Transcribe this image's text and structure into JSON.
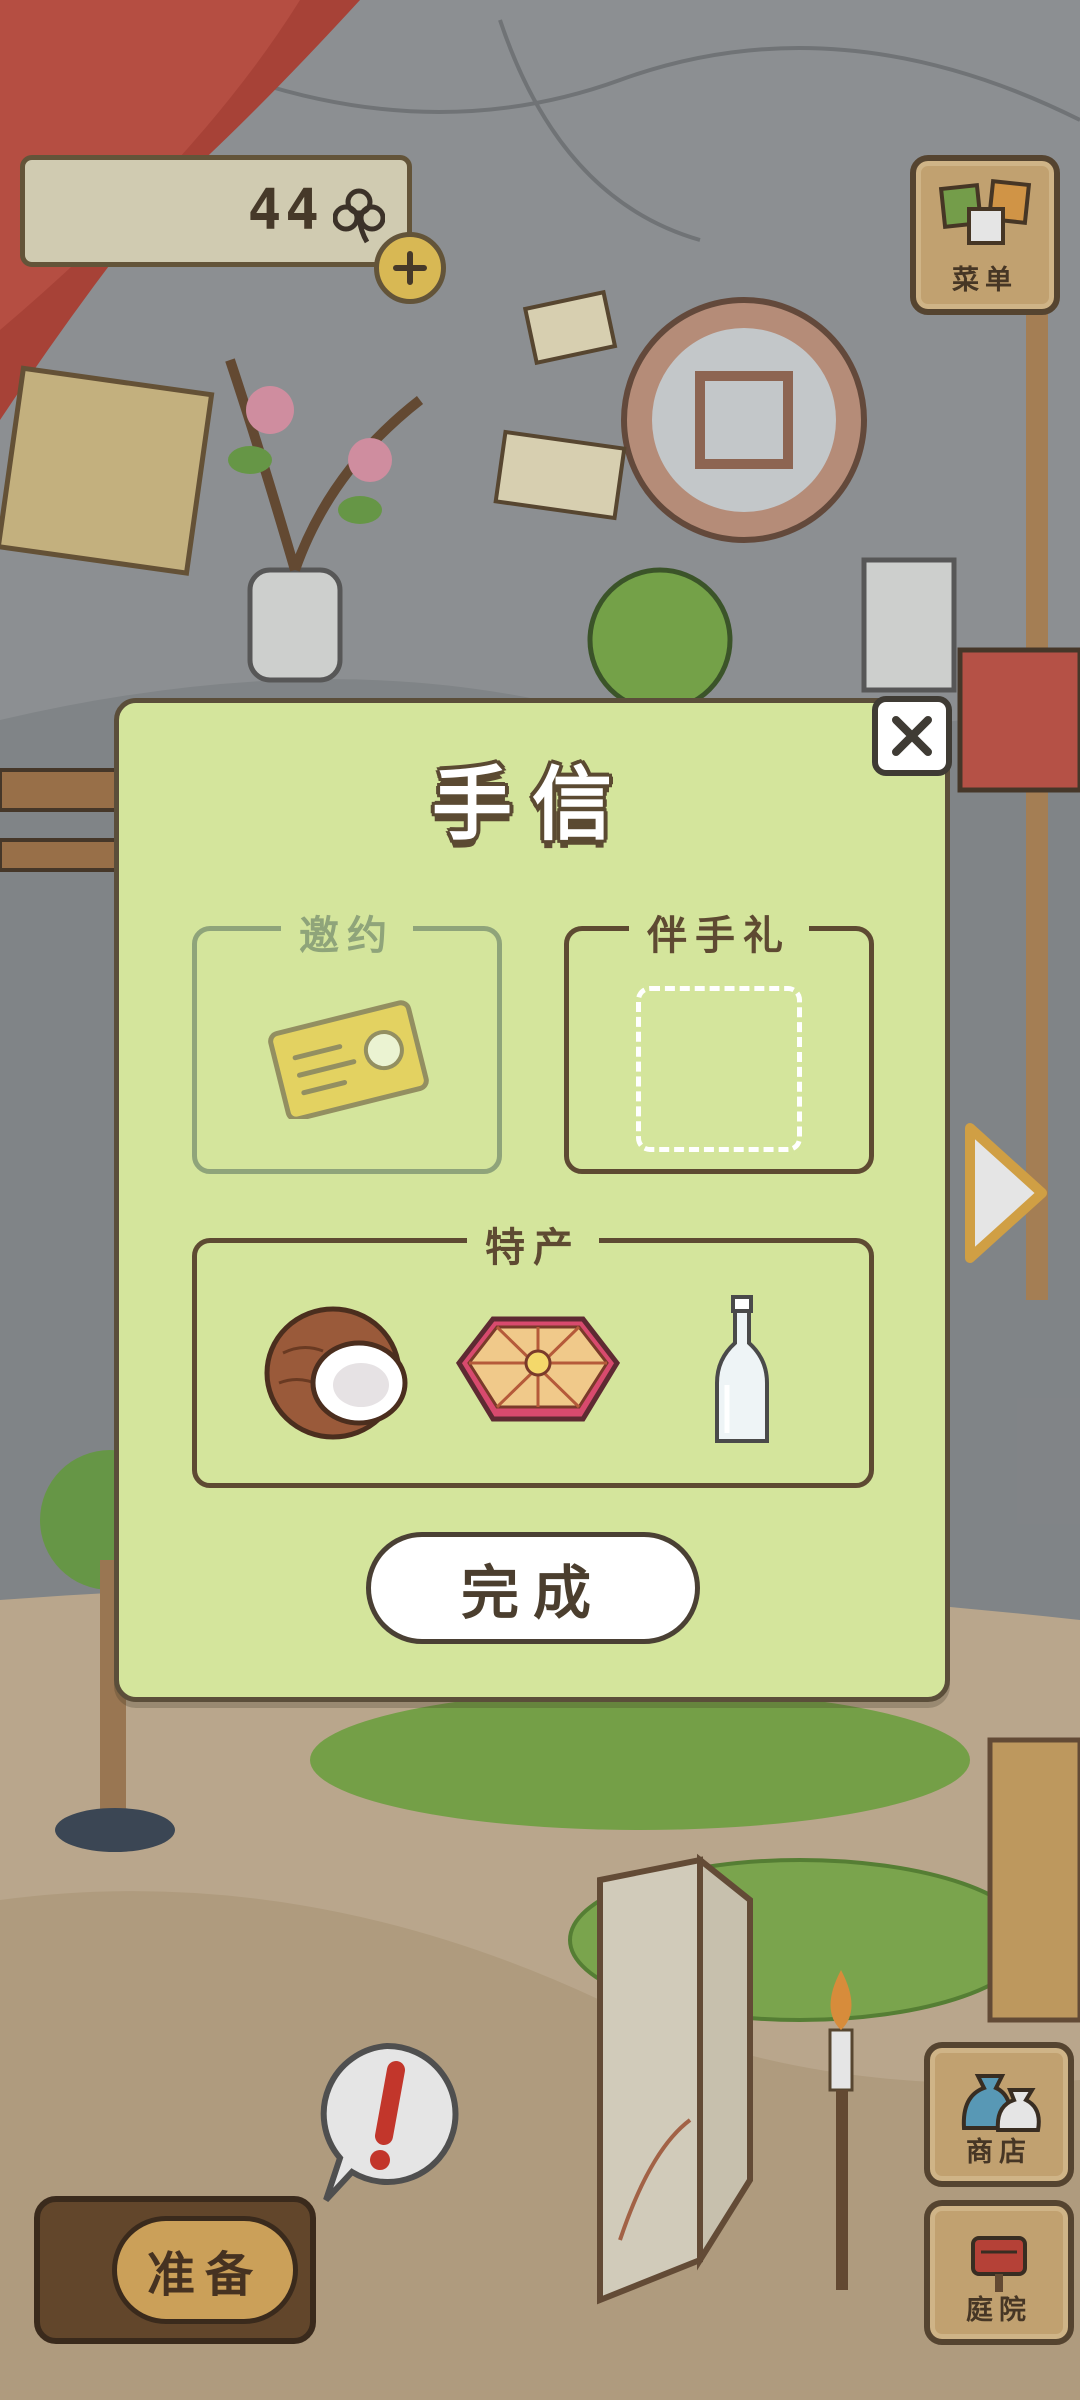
{
  "hud": {
    "clover_count": "44",
    "menu_label": "菜单",
    "shop_label": "商店",
    "yard_label": "庭院",
    "prepare_label": "准备"
  },
  "letter_dialog": {
    "title": "手信",
    "invite_label": "邀约",
    "souvenir_label": "伴手礼",
    "specialty_label": "特产",
    "specialty_items": [
      "coconut-icon",
      "snack-box-icon",
      "glass-bottle-icon"
    ],
    "done_label": "完成"
  },
  "colors": {
    "panel_bg": "#d4e59c",
    "panel_border": "#5b4e3a",
    "wood": "#d7b27a",
    "gold": "#f1cc5a"
  }
}
